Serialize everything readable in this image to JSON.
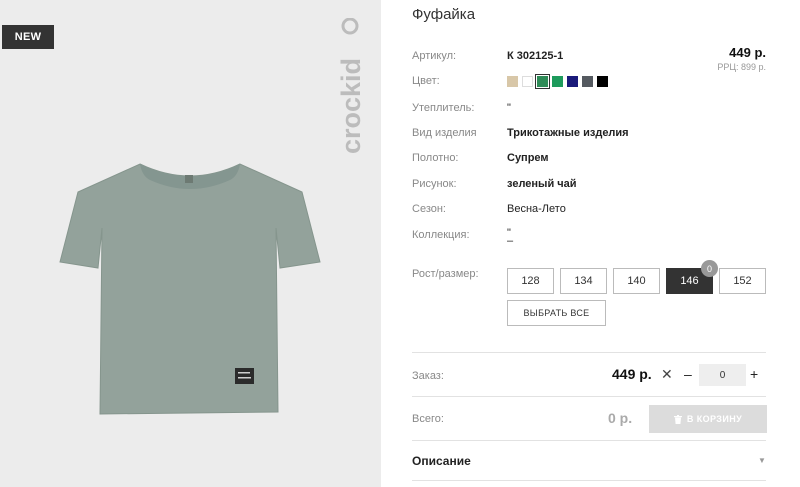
{
  "badge": {
    "new": "NEW"
  },
  "brand": {
    "logo_text": "crockid"
  },
  "product": {
    "title": "Фуфайка",
    "price": "449 р.",
    "rrp": "РРЦ: 899 р."
  },
  "attributes": {
    "article_label": "Артикул:",
    "article_value": "К 302125-1",
    "color_label": "Цвет:",
    "insulation_label": "Утеплитель:",
    "insulation_value": "\"",
    "type_label": "Вид изделия",
    "type_value": "Трикотажные изделия",
    "fabric_label": "Полотно:",
    "fabric_value": "Супрем",
    "pattern_label": "Рисунок:",
    "pattern_value": "зеленый чай",
    "season_label": "Сезон:",
    "season_value": "Весна-Лето",
    "collection_label": "Коллекция:",
    "collection_value": "\"",
    "collection_value2": "–",
    "size_label": "Рост/размер:"
  },
  "colors": [
    "#d8c7a8",
    "#ffffff",
    "#2e8b57",
    "#1e9b5c",
    "#1a1a7a",
    "#555a60",
    "#000000"
  ],
  "selected_color_index": 2,
  "sizes": [
    {
      "label": "128",
      "active": false
    },
    {
      "label": "134",
      "active": false
    },
    {
      "label": "140",
      "active": false
    },
    {
      "label": "146",
      "active": true,
      "count": "0"
    },
    {
      "label": "152",
      "active": false
    }
  ],
  "select_all_label": "ВЫБРАТЬ ВСЕ",
  "order": {
    "label": "Заказ:",
    "price": "449 р.",
    "times": "✕",
    "minus": "–",
    "quantity": "0",
    "plus": "+"
  },
  "total": {
    "label": "Всего:",
    "value": "0 р.",
    "cart_button": "В КОРЗИНУ"
  },
  "description": {
    "label": "Описание",
    "arrow": "▼"
  }
}
